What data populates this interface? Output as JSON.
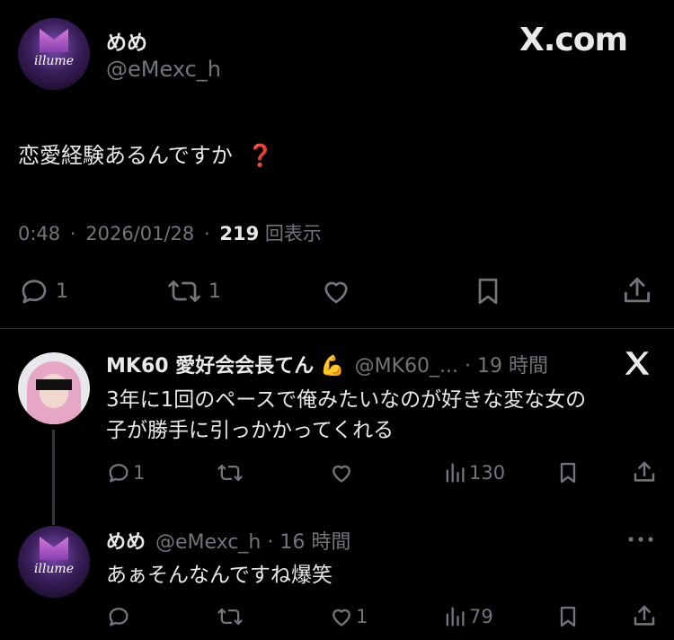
{
  "main_tweet": {
    "display_name": "めめ",
    "handle": "@eMexc_h",
    "brand": "X.com",
    "text": "恋愛経験あるんですか",
    "emoji": "❓",
    "time": "0:48",
    "sep": "·",
    "date": "2026/01/28",
    "views_count": "219",
    "views_label": "回表示",
    "reply_count": "1",
    "retweet_count": "1",
    "avatar_text": "illume"
  },
  "reply1": {
    "display_name": "MK60 愛好会会長てん",
    "emoji": "💪",
    "handle": "@MK60_...",
    "sep": "·",
    "time": "19 時間",
    "text_line1": "3年に1回のペースで俺みたいなのが好きな変な女の",
    "text_line2": "子が勝手に引っかかってくれる",
    "reply_count": "1",
    "views_count": "130"
  },
  "reply2": {
    "display_name": "めめ",
    "handle": "@eMexc_h",
    "sep": "·",
    "time": "16 時間",
    "text": "あぁそんなんですね爆笑",
    "like_count": "1",
    "views_count": "79",
    "avatar_text": "illume"
  },
  "colors": {
    "bg": "#000000",
    "text": "#e7e9ea",
    "muted": "#71767b",
    "divider": "#2f3336",
    "emoji_red": "#e0245e"
  }
}
